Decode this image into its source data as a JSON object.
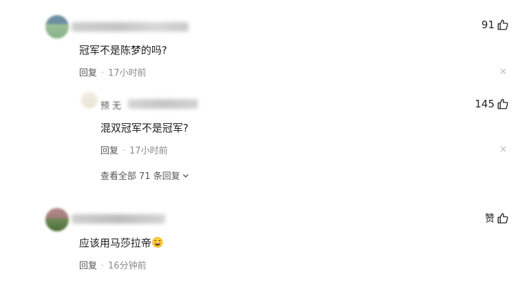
{
  "comments": [
    {
      "text": "冠军不是陈梦的吗?",
      "likes": "91",
      "reply_label": "回复",
      "time": "17小时前"
    },
    {
      "text": "应该用马莎拉帝",
      "likes": "赞",
      "reply_label": "回复",
      "time": "16分钟前",
      "emoji": "laughing-face-icon"
    }
  ],
  "reply": {
    "name_partial": "预   无",
    "text": "混双冠军不是冠军?",
    "likes": "145",
    "reply_label": "回复",
    "time": "17小时前"
  },
  "view_all_label": "查看全部 71 条回复",
  "meta_separator": "·",
  "colors": {
    "text_primary": "#1a1a1a",
    "text_secondary": "#8a8a8a",
    "reply_link": "#555555"
  }
}
